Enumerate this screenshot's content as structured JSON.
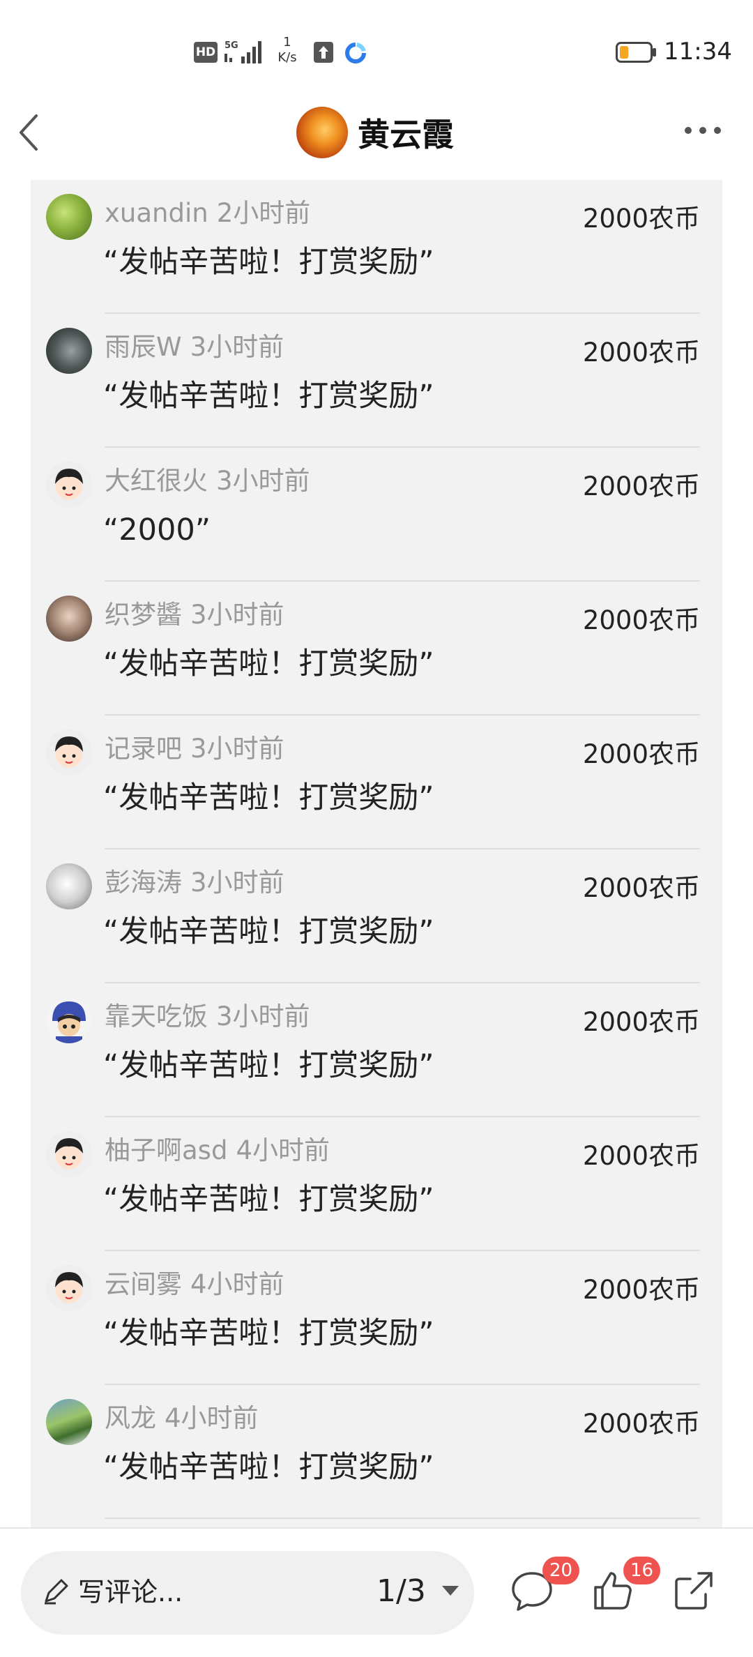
{
  "status_bar": {
    "hd": "HD",
    "network": "5G",
    "speed_value": "1",
    "speed_unit": "K/s",
    "time": "11:34",
    "battery_level": 0.15,
    "battery_color": "#f5a623"
  },
  "header": {
    "title": "黄云霞"
  },
  "rewards": [
    {
      "name": "xuandin",
      "time": "2小时前",
      "message": "“发帖辛苦啦！打赏奖励”",
      "amount": "2000农币"
    },
    {
      "name": "雨辰W",
      "time": "3小时前",
      "message": "“发帖辛苦啦！打赏奖励”",
      "amount": "2000农币"
    },
    {
      "name": "大红很火",
      "time": "3小时前",
      "message": "“2000”",
      "amount": "2000农币"
    },
    {
      "name": "织梦醬",
      "time": "3小时前",
      "message": "“发帖辛苦啦！打赏奖励”",
      "amount": "2000农币"
    },
    {
      "name": "记录吧",
      "time": "3小时前",
      "message": "“发帖辛苦啦！打赏奖励”",
      "amount": "2000农币"
    },
    {
      "name": "彭海涛",
      "time": "3小时前",
      "message": "“发帖辛苦啦！打赏奖励”",
      "amount": "2000农币"
    },
    {
      "name": "靠天吃饭",
      "time": "3小时前",
      "message": "“发帖辛苦啦！打赏奖励”",
      "amount": "2000农币"
    },
    {
      "name": "柚子啊asd",
      "time": "4小时前",
      "message": "“发帖辛苦啦！打赏奖励”",
      "amount": "2000农币"
    },
    {
      "name": "云间雾",
      "time": "4小时前",
      "message": "“发帖辛苦啦！打赏奖励”",
      "amount": "2000农币"
    },
    {
      "name": "风龙",
      "time": "4小时前",
      "message": "“发帖辛苦啦！打赏奖励”",
      "amount": "2000农币"
    }
  ],
  "bottom_bar": {
    "comment_label": "写评论...",
    "page_indicator": "1/3",
    "comment_count": "20",
    "like_count": "16"
  },
  "icons": {
    "back": "back-arrow-icon",
    "more": "more-icon",
    "pen": "pen-icon",
    "caret": "caret-down-icon",
    "comment": "comment-icon",
    "like": "like-icon",
    "share": "share-icon"
  },
  "colors": {
    "badge": "#ef5350",
    "panel_bg": "#f2f2f2"
  }
}
